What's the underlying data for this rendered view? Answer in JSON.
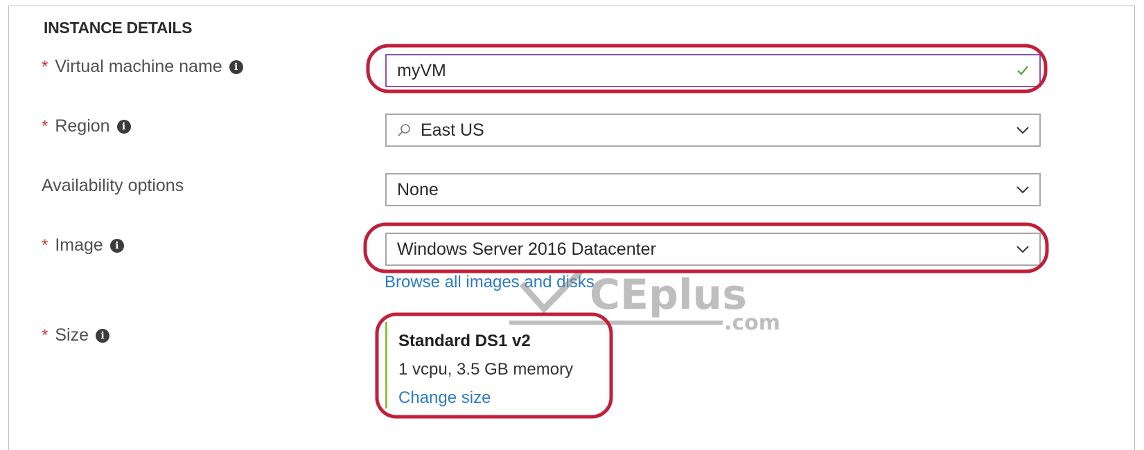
{
  "section": {
    "title": "INSTANCE DETAILS"
  },
  "fields": {
    "vm_name": {
      "required_mark": "*",
      "label": "Virtual machine name",
      "info_icon": "i",
      "value": "myVM"
    },
    "region": {
      "required_mark": "*",
      "label": "Region",
      "info_icon": "i",
      "value": "East US"
    },
    "availability": {
      "label": "Availability options",
      "value": "None"
    },
    "image": {
      "required_mark": "*",
      "label": "Image",
      "info_icon": "i",
      "value": "Windows Server 2016 Datacenter",
      "browse_link": "Browse all images and disks"
    },
    "size": {
      "required_mark": "*",
      "label": "Size",
      "info_icon": "i",
      "name": "Standard DS1 v2",
      "spec": "1 vcpu, 3.5 GB memory",
      "change_link": "Change size"
    }
  },
  "watermark": {
    "brand": "CEplus",
    "suffix": ".com"
  },
  "colors": {
    "annotation": "#c0203a",
    "link": "#2c7bc7",
    "required": "#d13438",
    "valid_check": "#5aa83c",
    "size_accent": "#8fbf3a"
  },
  "icons": {
    "valid": "checkmark-icon",
    "dropdown": "chevron-down-icon",
    "search": "search-icon",
    "info": "info-icon"
  }
}
